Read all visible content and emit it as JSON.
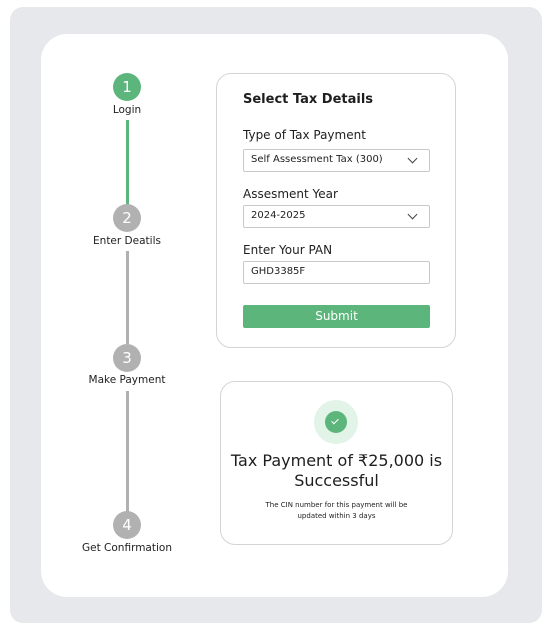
{
  "colors": {
    "accent": "#5cb67b",
    "inactive_step": "#b1b1b1",
    "background": "#e7e8eb",
    "card": "#ffffff"
  },
  "stepper": {
    "steps": [
      {
        "number": "1",
        "label": "Login",
        "status": "completed"
      },
      {
        "number": "2",
        "label": "Enter Deatils",
        "status": "pending"
      },
      {
        "number": "3",
        "label": "Make Payment",
        "status": "pending"
      },
      {
        "number": "4",
        "label": "Get Confirmation",
        "status": "pending"
      }
    ]
  },
  "form": {
    "title": "Select Tax Details",
    "tax_type": {
      "label": "Type of Tax Payment",
      "value": "Self Assessment Tax (300)",
      "icon": "chevron-down-icon"
    },
    "assessment_year": {
      "label": "Assesment Year",
      "value": "2024-2025",
      "icon": "chevron-down-icon"
    },
    "pan": {
      "label": "Enter Your PAN",
      "value": "GHD3385F"
    },
    "submit_label": "Submit"
  },
  "success": {
    "icon": "check-circle-icon",
    "title": "Tax Payment of ₹25,000 is Successful",
    "note": "The CIN number for this payment will be updated within 3 days"
  }
}
